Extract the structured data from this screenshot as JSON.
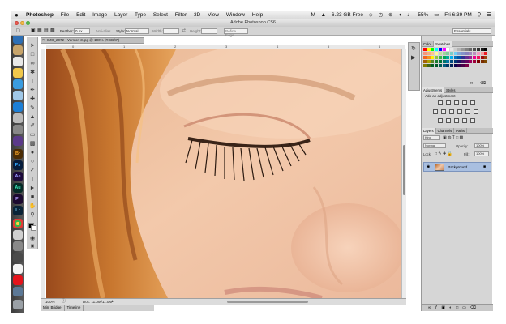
{
  "menubar": {
    "app_name": "Photoshop",
    "menus": [
      "File",
      "Edit",
      "Image",
      "Layer",
      "Type",
      "Select",
      "Filter",
      "3D",
      "View",
      "Window",
      "Help"
    ],
    "free_space": "6.23 GB Free",
    "battery": "55%",
    "clock": "Fri 6:39 PM"
  },
  "window": {
    "title": "Adobe Photoshop CS6"
  },
  "options_bar": {
    "feather_label": "Feather:",
    "feather_value": "0 px",
    "anti_alias_label": "Anti-alias",
    "style_label": "Style:",
    "style_value": "Normal",
    "width_label": "Width:",
    "height_label": "Height:",
    "refine_edge_label": "Refine Edge...",
    "workspace_value": "Essentials"
  },
  "document": {
    "tab_title": "IMG_2072 - Version 3.jpg @ 100% (RGB/8*)",
    "ruler_ticks": [
      "0",
      "1",
      "2",
      "3",
      "4",
      "5",
      "6",
      "7"
    ],
    "zoom": "100%",
    "doc_size": "Doc: 11.0M/11.0M"
  },
  "bottom_tabs": [
    "Mini Bridge",
    "Timeline"
  ],
  "panels": {
    "color_tabs": [
      "Color",
      "Swatches"
    ],
    "color_active": "Swatches",
    "adjust_tabs": [
      "Adjustments",
      "Styles"
    ],
    "adjust_active": "Adjustments",
    "add_adjustment": "Add an adjustment",
    "layer_tabs": [
      "Layers",
      "Channels",
      "Paths"
    ],
    "layer_active": "Layers",
    "kind_label": "Kind",
    "blend_mode": "Normal",
    "opacity_label": "Opacity:",
    "opacity_value": "100%",
    "lock_label": "Lock:",
    "fill_label": "Fill:",
    "fill_value": "100%",
    "background_layer": "Background"
  },
  "dock_apps": [
    "Br",
    "Ps",
    "Ae",
    "Au",
    "Pr",
    "Lr"
  ],
  "colors": {
    "swatches": [
      "#ff0000",
      "#ffff00",
      "#00ff00",
      "#00ffff",
      "#0000ff",
      "#ff00ff",
      "#ffffff",
      "#e6e6e6",
      "#cccccc",
      "#b3b3b3",
      "#999999",
      "#808080",
      "#666666",
      "#4d4d4d",
      "#333333",
      "#1a1a1a",
      "#000000",
      "#f7977a",
      "#f9ad81",
      "#fdc68a",
      "#fff79a",
      "#c4df9b",
      "#a2d39c",
      "#82ca9d",
      "#7bcdc8",
      "#6ecff6",
      "#7ea7d8",
      "#8493ca",
      "#8882be",
      "#a187be",
      "#bc8dbf",
      "#f49ac2",
      "#f6989d",
      "#ed1c24",
      "#f26522",
      "#f7941d",
      "#fff200",
      "#8dc73f",
      "#39b54a",
      "#00a651",
      "#00a99d",
      "#00aeef",
      "#0072bc",
      "#0054a6",
      "#2e3192",
      "#662d91",
      "#92278f",
      "#ec008c",
      "#ed145b",
      "#9e0b0f",
      "#a0410d",
      "#a36209",
      "#aba000",
      "#598527",
      "#1a7b30",
      "#007236",
      "#00746b",
      "#0076a3",
      "#004a80",
      "#003471",
      "#1b1464",
      "#440e62",
      "#630460",
      "#9e005d",
      "#9e0039",
      "#790000",
      "#7b2e00",
      "#7d4900",
      "#827b00",
      "#406618",
      "#005e20",
      "#005826",
      "#005952",
      "#005b7f",
      "#003663",
      "#002157",
      "#0d004c",
      "#32004b",
      "#4b0049",
      "#7b0046"
    ]
  }
}
